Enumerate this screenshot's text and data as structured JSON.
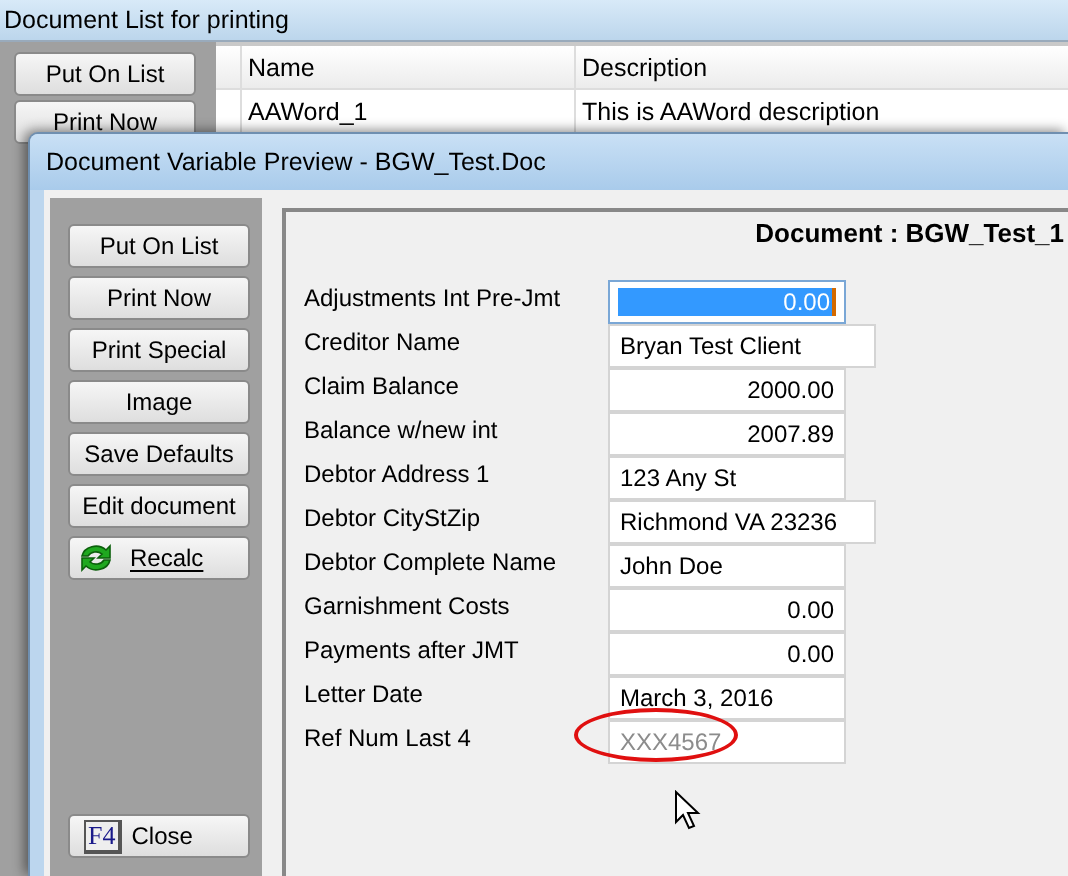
{
  "back_window": {
    "title": "Document List for printing",
    "buttons": [
      "Put On List",
      "Print Now"
    ],
    "table": {
      "columns": [
        "Name",
        "Description"
      ],
      "rows": [
        [
          "AAWord_1",
          "This is AAWord description"
        ]
      ]
    }
  },
  "dialog": {
    "title": "Document Variable Preview - BGW_Test.Doc",
    "buttons": [
      {
        "kind": "plain",
        "label": "Put On List"
      },
      {
        "kind": "plain",
        "label": "Print Now"
      },
      {
        "kind": "plain",
        "label": "Print Special"
      },
      {
        "kind": "plain",
        "label": "Image"
      },
      {
        "kind": "plain",
        "label": "Save Defaults"
      },
      {
        "kind": "plain",
        "label": "Edit document"
      },
      {
        "kind": "recalc",
        "label": "Recalc"
      }
    ],
    "close_button": {
      "key": "F4",
      "label": "Close"
    },
    "heading": "Document : BGW_Test_1",
    "fields": [
      {
        "label": "Adjustments Int Pre-Jmt",
        "value": "0.00",
        "kind": "number",
        "selected": true,
        "wide": false,
        "disabled": false
      },
      {
        "label": "Creditor Name",
        "value": "Bryan Test Client",
        "kind": "text",
        "selected": false,
        "wide": true,
        "disabled": false
      },
      {
        "label": "Claim Balance",
        "value": "2000.00",
        "kind": "number",
        "selected": false,
        "wide": false,
        "disabled": false
      },
      {
        "label": "Balance w/new int",
        "value": "2007.89",
        "kind": "number",
        "selected": false,
        "wide": false,
        "disabled": false
      },
      {
        "label": "Debtor Address 1",
        "value": "123 Any St",
        "kind": "text",
        "selected": false,
        "wide": false,
        "disabled": false
      },
      {
        "label": "Debtor CityStZip",
        "value": "Richmond VA 23236",
        "kind": "text",
        "selected": false,
        "wide": true,
        "disabled": false
      },
      {
        "label": "Debtor Complete Name",
        "value": "John Doe",
        "kind": "text",
        "selected": false,
        "wide": false,
        "disabled": false
      },
      {
        "label": "Garnishment Costs",
        "value": "0.00",
        "kind": "number",
        "selected": false,
        "wide": false,
        "disabled": false
      },
      {
        "label": "Payments after JMT",
        "value": "0.00",
        "kind": "number",
        "selected": false,
        "wide": false,
        "disabled": false
      },
      {
        "label": "Letter Date",
        "value": "March 3, 2016",
        "kind": "text",
        "selected": false,
        "wide": false,
        "disabled": false
      },
      {
        "label": "Ref Num Last 4",
        "value": "XXX4567",
        "kind": "text",
        "selected": false,
        "wide": false,
        "disabled": true,
        "circled": true
      }
    ]
  }
}
